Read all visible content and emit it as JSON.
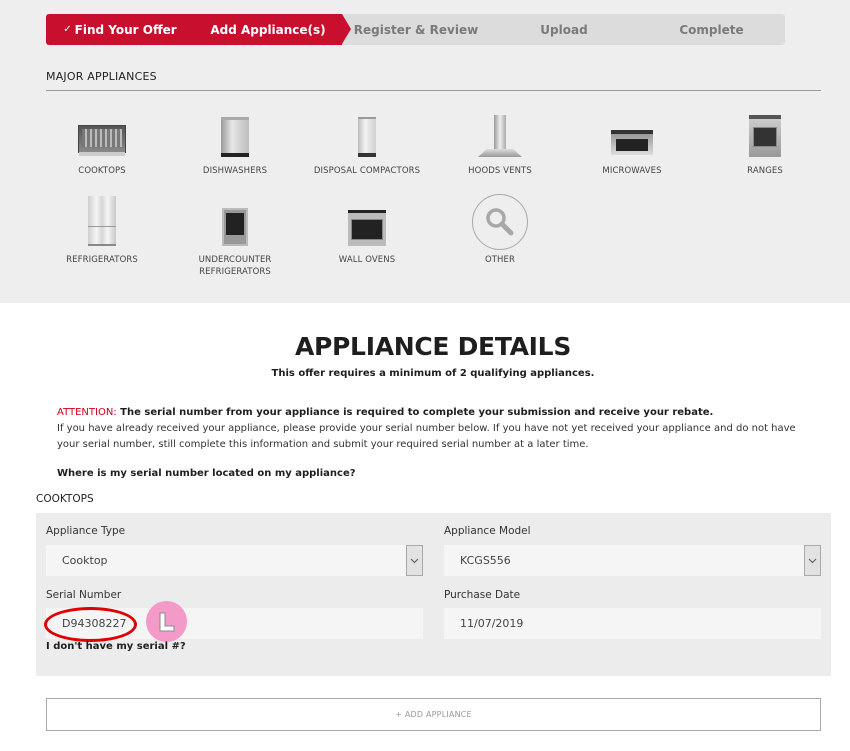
{
  "stepper": {
    "steps": [
      {
        "label": "Find Your Offer",
        "state": "done",
        "check": "✓"
      },
      {
        "label": "Add Appliance(s)",
        "state": "active"
      },
      {
        "label": "Register & Review",
        "state": "pending"
      },
      {
        "label": "Upload",
        "state": "pending"
      },
      {
        "label": "Complete",
        "state": "pending"
      }
    ]
  },
  "major_appliances": {
    "title": "MAJOR APPLIANCES",
    "items": [
      {
        "label": "COOKTOPS",
        "icon": "cooktop-icon"
      },
      {
        "label": "DISHWASHERS",
        "icon": "dishwasher-icon"
      },
      {
        "label": "DISPOSAL COMPACTORS",
        "icon": "compactor-icon"
      },
      {
        "label": "HOODS VENTS",
        "icon": "hood-icon"
      },
      {
        "label": "MICROWAVES",
        "icon": "microwave-icon"
      },
      {
        "label": "RANGES",
        "icon": "range-icon"
      },
      {
        "label": "REFRIGERATORS",
        "icon": "refrigerator-icon"
      },
      {
        "label": "UNDERCOUNTER REFRIGERATORS",
        "icon": "undercounter-refrigerator-icon"
      },
      {
        "label": "WALL OVENS",
        "icon": "wall-oven-icon"
      },
      {
        "label": "OTHER",
        "icon": "search-icon"
      }
    ]
  },
  "details": {
    "title": "APPLIANCE DETAILS",
    "subtitle": "This offer requires a minimum of 2 qualifying appliances.",
    "attention_label": "ATTENTION:",
    "attention_bold": " The serial number from your appliance is required to complete your submission and receive your rebate.",
    "attention_body": "If you have already received your appliance, please provide your serial number below. If you have not yet received your appliance and do not have your serial number, still complete this information and submit your required serial number at a later time.",
    "serial_location_link": "Where is my serial number located on my appliance?"
  },
  "form": {
    "group_label": "COOKTOPS",
    "appliance_type": {
      "label": "Appliance Type",
      "value": "Cooktop"
    },
    "appliance_model": {
      "label": "Appliance Model",
      "value": "KCGS556"
    },
    "serial_number": {
      "label": "Serial Number",
      "value": "D94308227"
    },
    "purchase_date": {
      "label": "Purchase Date",
      "value": "11/07/2019"
    },
    "no_serial_link": "I don't have my serial #?",
    "badge_letter": "L"
  },
  "add_appliance_button": "+ ADD APPLIANCE",
  "colors": {
    "brand_red": "#c8102e",
    "attention_red": "#d0021b",
    "annotation_oval": "#e00000",
    "badge_pink": "#f49ac8"
  }
}
